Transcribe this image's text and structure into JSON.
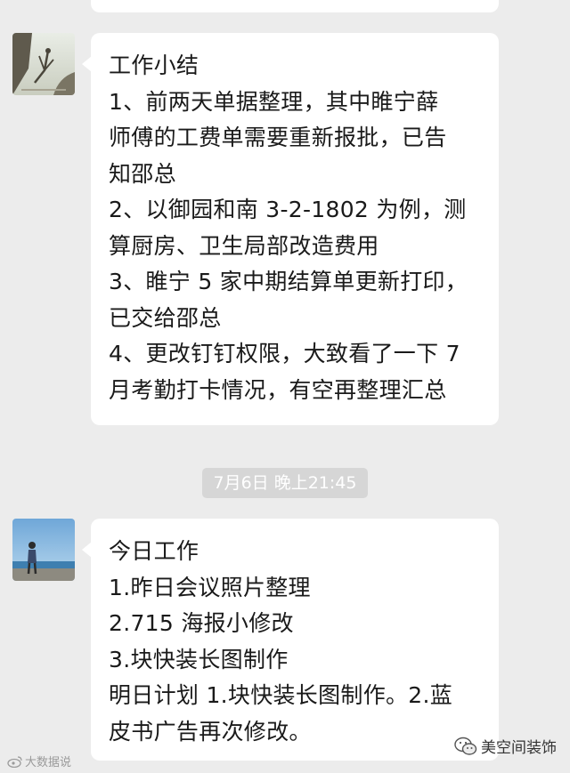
{
  "messages": [
    {
      "lines": [
        "工作小结",
        "1、前两天单据整理，其中睢宁薛",
        "师傅的工费单需要重新报批，已告",
        "知邵总",
        "2、以御园和南 3-2-1802 为例，测",
        "算厨房、卫生局部改造费用",
        "3、睢宁 5 家中期结算单更新打印，",
        "已交给邵总",
        "4、更改钉钉权限，大致看了一下 7",
        "月考勤打卡情况，有空再整理汇总"
      ]
    },
    {
      "lines": [
        "今日工作",
        "1.昨日会议照片整理",
        "2.715 海报小修改",
        "3.块快装长图制作",
        "明日计划 1.块快装长图制作。2.蓝",
        "皮书广告再次修改。"
      ]
    }
  ],
  "timestamp": "7月6日 晚上21:45",
  "watermarks": {
    "left": "大数据说",
    "right": "美空间装饰"
  },
  "icons": {
    "left_watermark": "weibo-icon",
    "right_watermark": "wechat-icon"
  },
  "colors": {
    "background": "#ececec",
    "bubble": "#ffffff",
    "timestamp_bg": "#d6d6d6",
    "text": "#1a1a1a"
  }
}
